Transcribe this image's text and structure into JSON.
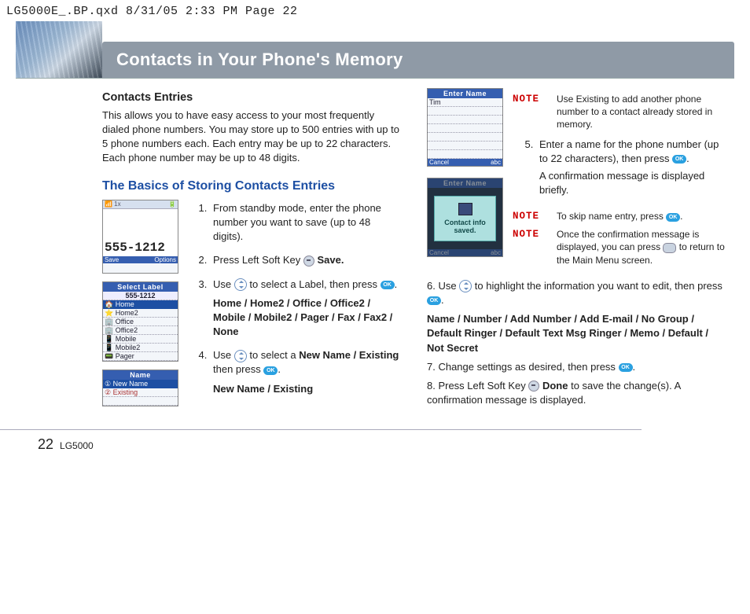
{
  "crop_header": "LG5000E_.BP.qxd  8/31/05  2:33 PM  Page 22",
  "page_title": "Contacts in Your Phone's Memory",
  "left": {
    "h_entries": "Contacts Entries",
    "p_entries": "This allows you to have easy access to your most frequently dialed phone numbers. You may store up to 500 entries with up to 5 phone numbers each. Each entry may be up to 22 characters. Each phone number may be up to 48 digits.",
    "h_basics": "The Basics of Storing Contacts Entries",
    "thumb1": {
      "status_l": "📶 1x",
      "status_r": "🔋",
      "number": "555-1212",
      "soft_l": "Save",
      "soft_r": "Options"
    },
    "thumb2": {
      "title": "Select Label",
      "header": "555-1212",
      "sel": "Home",
      "items": [
        "Home2",
        "Office",
        "Office2",
        "Mobile",
        "Mobile2",
        "Pager"
      ]
    },
    "thumb3": {
      "title": "Name",
      "row1": "① New Name",
      "row2": "② Existing"
    },
    "step1": "From standby mode, enter the phone number you want to save (up to 48 digits).",
    "step2_a": "Press Left Soft Key ",
    "step2_b": " Save.",
    "step3_a": "Use ",
    "step3_b": " to select a Label, then press ",
    "step3_c": ".",
    "step3_opts": "Home / Home2 / Office / Office2 / Mobile / Mobile2 / Pager / Fax / Fax2 / None",
    "step4_a": "Use ",
    "step4_b": " to select a ",
    "step4_bold": "New Name / Existing",
    "step4_c": " then press ",
    "step4_d": ".",
    "step4_opts": "New Name / Existing"
  },
  "right": {
    "thumbA": {
      "title": "Enter Name",
      "row": "Tim",
      "soft_l": "Cancel",
      "soft_r": "abc"
    },
    "thumbB": {
      "title": "Enter Name",
      "msg1": "Contact info",
      "msg2": "saved.",
      "soft_l": "Cancel",
      "soft_r": "abc"
    },
    "note1": "Use Existing to add another phone number to a contact already stored in memory.",
    "step5_a": "Enter a name for the phone number (up to 22 characters), then press ",
    "step5_b": ".",
    "step5_c": "A confirmation message is displayed briefly.",
    "note2_a": "To skip name entry, press ",
    "note2_b": ".",
    "note3_a": "Once the confirmation message is displayed, you can press ",
    "note3_b": " to return   to the Main Menu screen.",
    "step6_a": "6.  Use  ",
    "step6_b": " to highlight the information you want to edit, then press ",
    "step6_c": ".",
    "step6_opts": "Name / Number / Add Number /  Add E-mail / No Group / Default Ringer / Default Text Msg Ringer / Memo / Default / Not Secret",
    "step7_a": "7. Change settings as desired, then press  ",
    "step7_b": ".",
    "step8_a": "8. Press Left Soft Key ",
    "step8_b": " Done",
    "step8_c": " to save the change(s). A confirmation message is displayed."
  },
  "note_label": "NOTE",
  "footer": {
    "page": "22",
    "model": "LG5000"
  }
}
